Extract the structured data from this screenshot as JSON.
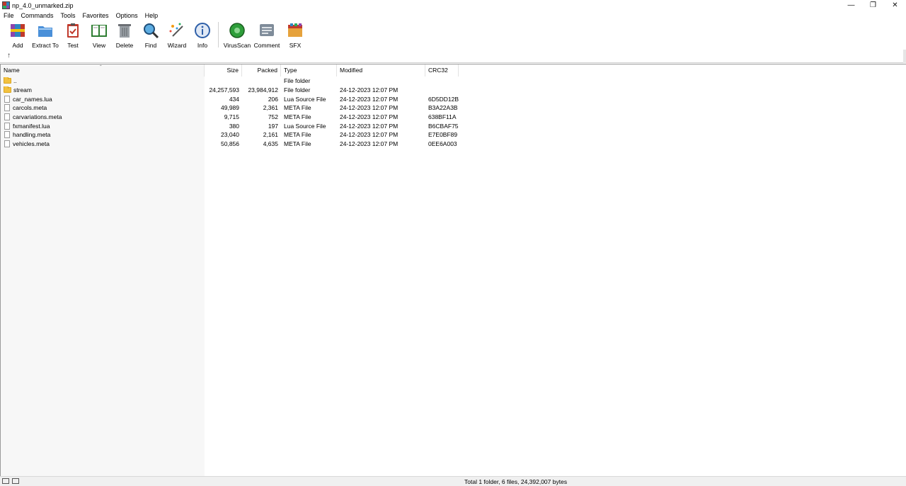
{
  "window": {
    "title": "np_4.0_unmarked.zip",
    "controls": {
      "minimize": "—",
      "restore": "❐",
      "close": "✕"
    }
  },
  "menu": [
    "File",
    "Commands",
    "Tools",
    "Favorites",
    "Options",
    "Help"
  ],
  "toolbar": [
    {
      "label": "Add",
      "icon": "add-archive-icon"
    },
    {
      "label": "Extract To",
      "icon": "extract-folder-icon"
    },
    {
      "label": "Test",
      "icon": "test-clipboard-icon"
    },
    {
      "label": "View",
      "icon": "view-book-icon"
    },
    {
      "label": "Delete",
      "icon": "trash-icon"
    },
    {
      "label": "Find",
      "icon": "magnifier-icon"
    },
    {
      "label": "Wizard",
      "icon": "magic-wand-icon"
    },
    {
      "label": "Info",
      "icon": "info-icon"
    },
    {
      "label": "VirusScan",
      "icon": "virus-scan-icon"
    },
    {
      "label": "Comment",
      "icon": "comment-icon"
    },
    {
      "label": "SFX",
      "icon": "sfx-box-icon"
    }
  ],
  "columns": {
    "name": "Name",
    "size": "Size",
    "packed": "Packed",
    "type": "Type",
    "modified": "Modified",
    "crc": "CRC32"
  },
  "files": [
    {
      "name": "..",
      "size": "",
      "packed": "",
      "type": "File folder",
      "modified": "",
      "crc": "",
      "kind": "folder"
    },
    {
      "name": "stream",
      "size": "24,257,593",
      "packed": "23,984,912",
      "type": "File folder",
      "modified": "24-12-2023 12:07 PM",
      "crc": "",
      "kind": "folder"
    },
    {
      "name": "car_names.lua",
      "size": "434",
      "packed": "206",
      "type": "Lua Source File",
      "modified": "24-12-2023 12:07 PM",
      "crc": "6D5DD12B",
      "kind": "file"
    },
    {
      "name": "carcols.meta",
      "size": "49,989",
      "packed": "2,361",
      "type": "META File",
      "modified": "24-12-2023 12:07 PM",
      "crc": "B3A22A3B",
      "kind": "file"
    },
    {
      "name": "carvariations.meta",
      "size": "9,715",
      "packed": "752",
      "type": "META File",
      "modified": "24-12-2023 12:07 PM",
      "crc": "638BF11A",
      "kind": "file"
    },
    {
      "name": "fxmanifest.lua",
      "size": "380",
      "packed": "197",
      "type": "Lua Source File",
      "modified": "24-12-2023 12:07 PM",
      "crc": "B6CBAF75",
      "kind": "file"
    },
    {
      "name": "handling.meta",
      "size": "23,040",
      "packed": "2,161",
      "type": "META File",
      "modified": "24-12-2023 12:07 PM",
      "crc": "E7E0BF89",
      "kind": "file"
    },
    {
      "name": "vehicles.meta",
      "size": "50,856",
      "packed": "4,635",
      "type": "META File",
      "modified": "24-12-2023 12:07 PM",
      "crc": "0EE6A003",
      "kind": "file"
    }
  ],
  "status": {
    "text": "Total 1 folder, 6 files, 24,392,007 bytes"
  }
}
